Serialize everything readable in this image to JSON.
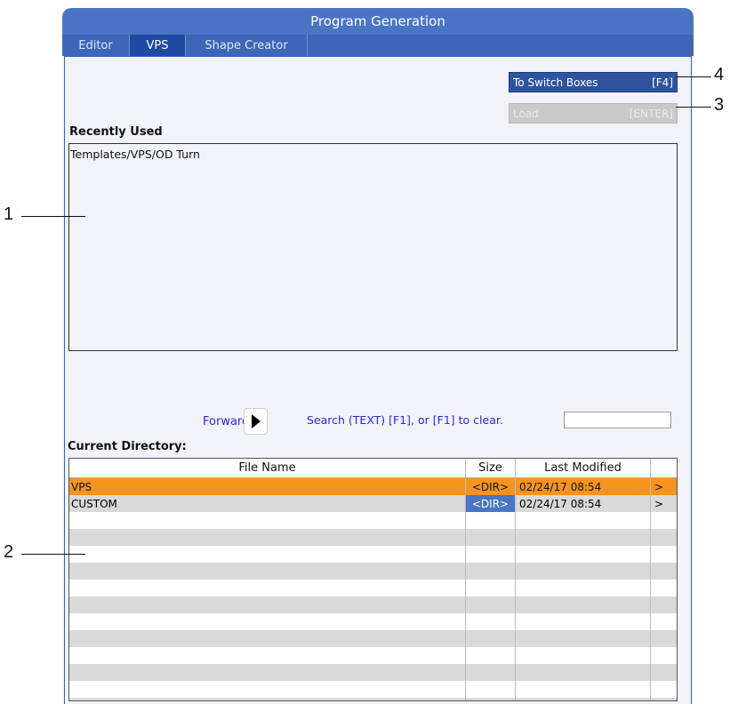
{
  "window": {
    "title": "Program Generation"
  },
  "tabs": [
    {
      "label": "Editor"
    },
    {
      "label": "VPS"
    },
    {
      "label": "Shape Creator"
    }
  ],
  "buttons": {
    "switch_label": "To Switch Boxes",
    "switch_key": "[F4]",
    "load_label": "Load",
    "load_key": "[ENTER]"
  },
  "recent": {
    "heading": "Recently Used",
    "items": [
      "Templates/VPS/OD Turn"
    ]
  },
  "nav": {
    "forward_label": "Forward",
    "search_hint": "Search (TEXT) [F1], or [F1] to clear.",
    "search_value": ""
  },
  "directory": {
    "heading": "Current Directory:",
    "columns": [
      "File Name",
      "Size",
      "Last Modified",
      ""
    ],
    "rows": [
      {
        "name": "VPS",
        "size": "<DIR>",
        "modified": "02/24/17 08:54",
        "arrow": ">"
      },
      {
        "name": "CUSTOM",
        "size": "<DIR>",
        "modified": "02/24/17 08:54",
        "arrow": ">"
      }
    ]
  },
  "callouts": [
    "1",
    "2",
    "3",
    "4"
  ],
  "colors": {
    "title_bar": "#4a74c4",
    "active_tab": "#1e4aa1",
    "selected_row": "#f7941d",
    "size_highlight": "#4a74c4"
  }
}
